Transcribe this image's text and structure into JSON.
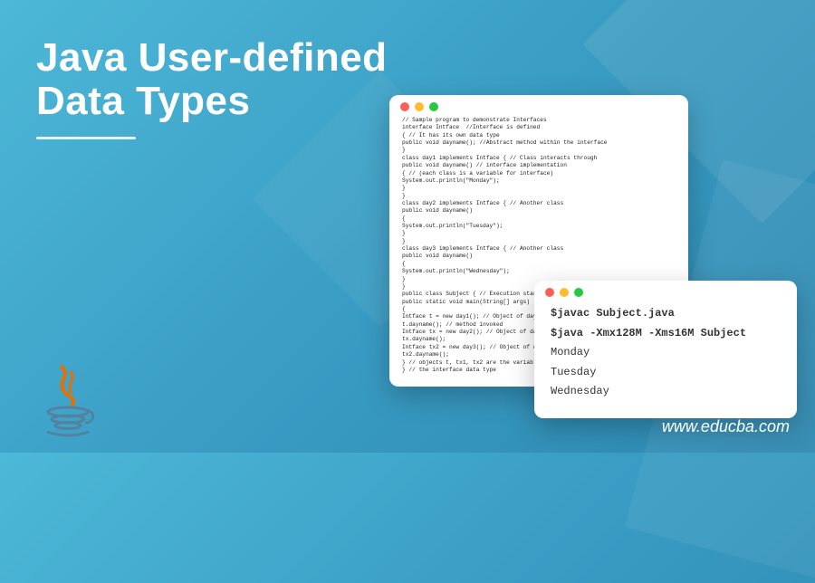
{
  "title_line1": "Java User-defined",
  "title_line2": "Data Types",
  "traffic_icons": {
    "red": "close-icon",
    "yellow": "minimize-icon",
    "green": "maximize-icon"
  },
  "code_window_big": {
    "content": "// Sample program to demonstrate Interfaces\ninterface Intface  //Interface is defined\n{ // It has its own data type\npublic void dayname(); //Abstract method within the interface\n}\nclass day1 implements Intface { // Class interacts through\npublic void dayname() // interface implementation\n{ // (each class is a variable for interface)\nSystem.out.println(\"Monday\");\n}\n}\nclass day2 implements Intface { // Another class\npublic void dayname()\n{\nSystem.out.println(\"Tuesday\");\n}\n}\nclass day3 implements Intface { // Another class\npublic void dayname()\n{\nSystem.out.println(\"Wednesday\");\n}\n}\npublic class Subject { // Execution starts here\npublic static void main(String[] args)\n{\nIntface t = new day1(); // Object of day1 class t\nt.dayname(); // method invoked\nIntface tx = new day2(); // Object of day2 class\ntx.dayname();\nIntface tx2 = new day3(); // Object of day3 class\ntx2.dayname();\n} // objects t, tx1, tx2 are the variables of\n} // the interface data type"
  },
  "code_window_small": {
    "cmd1": "$javac Subject.java",
    "cmd2": "$java -Xmx128M -Xms16M Subject",
    "out1": "Monday",
    "out2": "Tuesday",
    "out3": "Wednesday"
  },
  "logo_name": "java-logo",
  "website": "www.educba.com"
}
